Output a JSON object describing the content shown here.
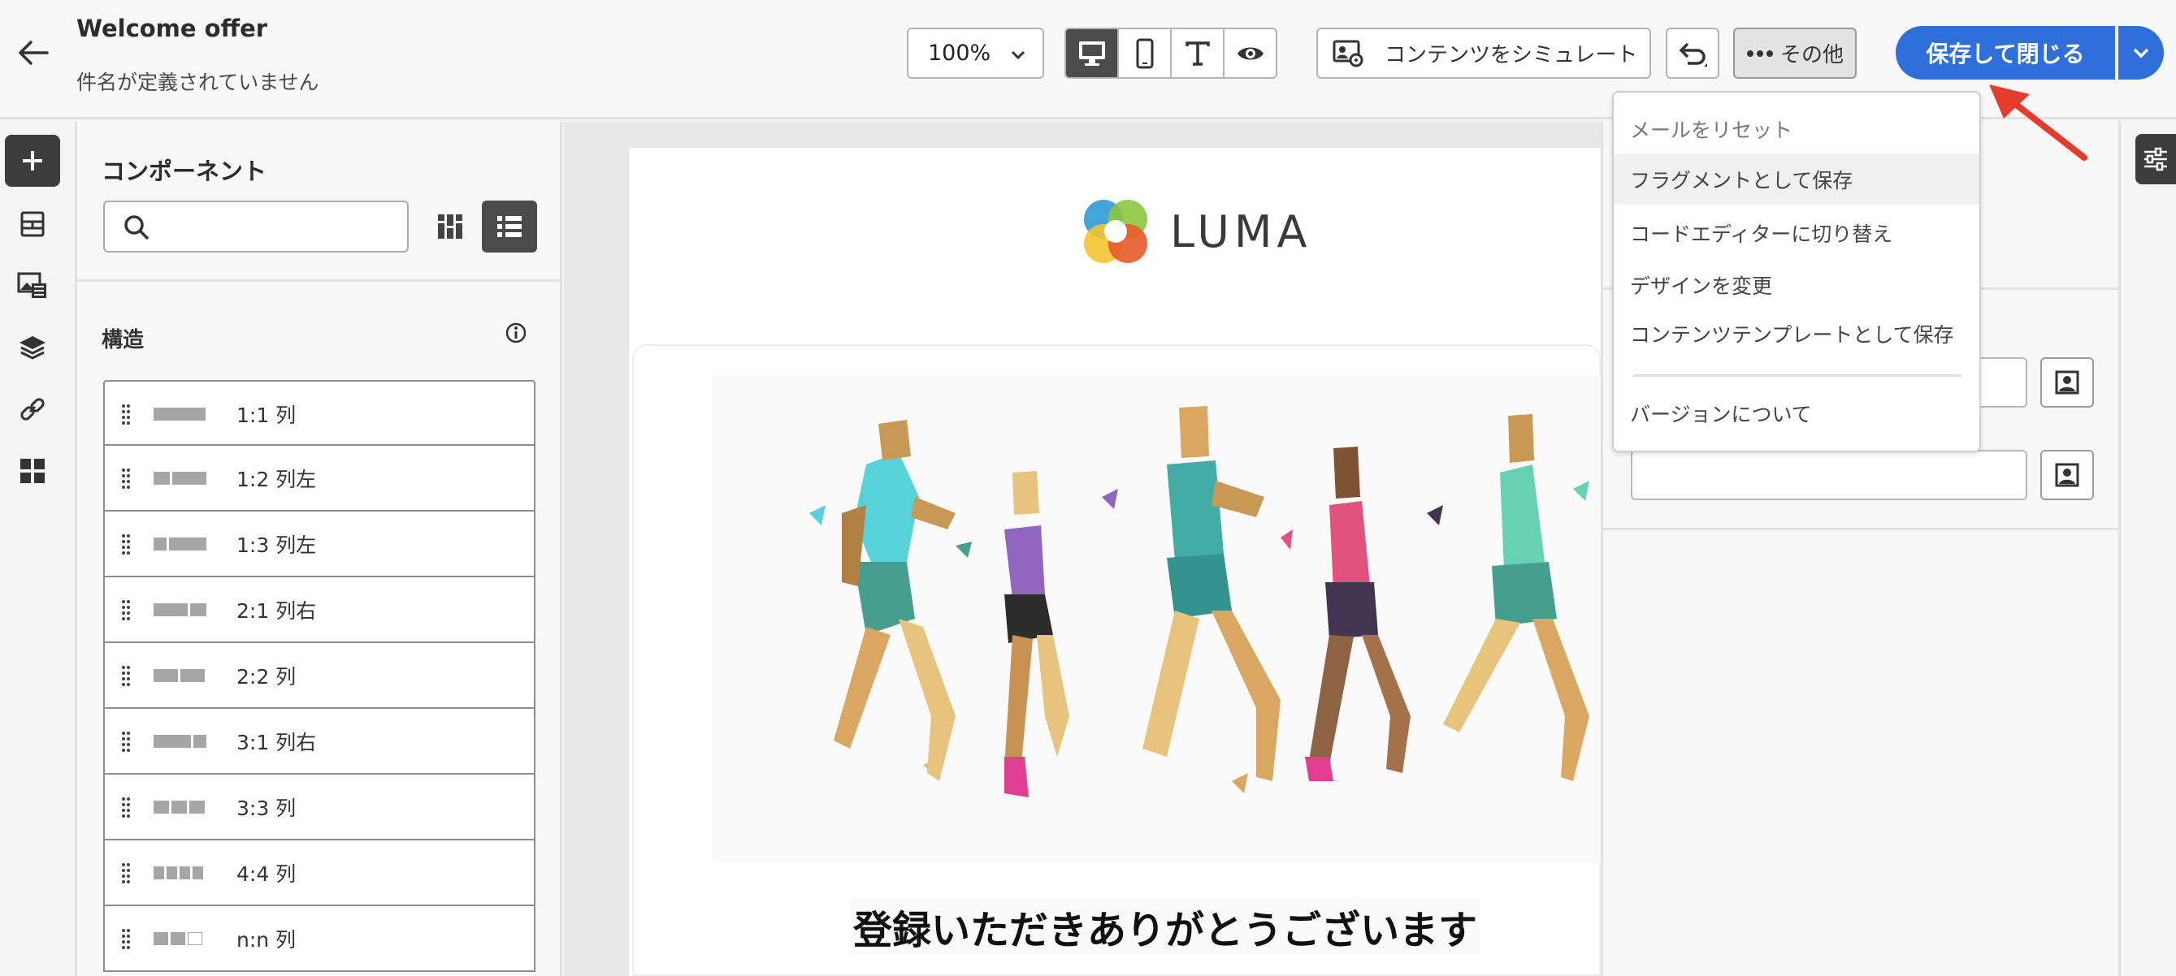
{
  "header": {
    "title": "Welcome offer",
    "subtitle": "件名が定義されていません",
    "zoom": "100%",
    "simulate_label": "コンテンツをシミュレート",
    "more_label": "その他",
    "save_label": "保存して閉じる"
  },
  "devices": [
    "desktop-icon",
    "mobile-icon",
    "text-icon",
    "eye-icon"
  ],
  "components_panel": {
    "title": "コンポーネント",
    "search_placeholder": "",
    "structure_title": "構造",
    "items": [
      {
        "label": "1:1 列"
      },
      {
        "label": "1:2 列左"
      },
      {
        "label": "1:3 列左"
      },
      {
        "label": "2:1 列右"
      },
      {
        "label": "2:2 列"
      },
      {
        "label": "3:1 列右"
      },
      {
        "label": "3:3 列"
      },
      {
        "label": "4:4 列"
      },
      {
        "label": "n:n 列"
      }
    ]
  },
  "email": {
    "logo_text": "LUMA",
    "heading": "登録いただきありがとうございます"
  },
  "more_menu": {
    "items": [
      {
        "label": "メールをリセット",
        "state": "disabled"
      },
      {
        "label": "フラグメントとして保存",
        "state": "hover"
      },
      {
        "label": "コードエディターに切り替え",
        "state": "normal"
      },
      {
        "label": "デザインを変更",
        "state": "normal"
      },
      {
        "label": "コンテンツテンプレートとして保存",
        "state": "normal"
      },
      {
        "label": "バージョンについて",
        "state": "normal"
      }
    ]
  },
  "colors": {
    "accent": "#2f6fdc",
    "callout_arrow": "#e53b2c"
  }
}
